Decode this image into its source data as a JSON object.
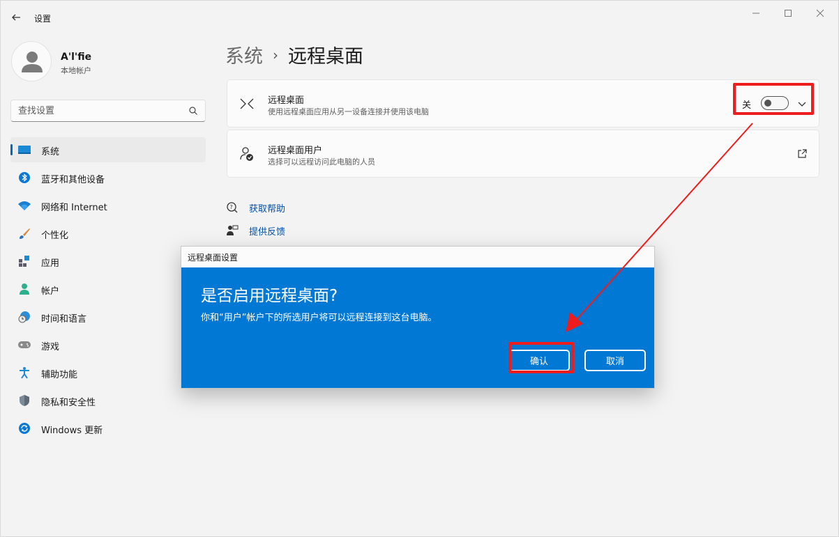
{
  "app": {
    "title": "设置"
  },
  "profile": {
    "name": "A'l'fie",
    "account_type": "本地帐户"
  },
  "search": {
    "placeholder": "查找设置"
  },
  "sidebar": {
    "items": [
      {
        "label": "系统",
        "icon": "system-icon",
        "active": true
      },
      {
        "label": "蓝牙和其他设备",
        "icon": "bluetooth-icon"
      },
      {
        "label": "网络和 Internet",
        "icon": "wifi-icon"
      },
      {
        "label": "个性化",
        "icon": "brush-icon"
      },
      {
        "label": "应用",
        "icon": "apps-icon"
      },
      {
        "label": "帐户",
        "icon": "account-icon"
      },
      {
        "label": "时间和语言",
        "icon": "globe-clock-icon"
      },
      {
        "label": "游戏",
        "icon": "gamepad-icon"
      },
      {
        "label": "辅助功能",
        "icon": "accessibility-icon"
      },
      {
        "label": "隐私和安全性",
        "icon": "shield-icon"
      },
      {
        "label": "Windows 更新",
        "icon": "update-icon"
      }
    ]
  },
  "breadcrumb": {
    "parent": "系统",
    "separator": "›",
    "current": "远程桌面"
  },
  "cards": {
    "remote_desktop": {
      "title": "远程桌面",
      "subtitle": "使用远程桌面应用从另一设备连接并使用该电脑",
      "toggle_state": "关"
    },
    "remote_users": {
      "title": "远程桌面用户",
      "subtitle": "选择可以远程访问此电脑的人员"
    }
  },
  "links": {
    "help": "获取帮助",
    "feedback": "提供反馈"
  },
  "dialog": {
    "title": "远程桌面设置",
    "heading": "是否启用远程桌面?",
    "body": "你和“用户”帐户下的所选用户将可以远程连接到这台电脑。",
    "confirm_label": "确认",
    "cancel_label": "取消"
  },
  "colors": {
    "accent": "#0067c0",
    "dialog_bg": "#0078d4",
    "annotation": "#ee1c1c"
  }
}
